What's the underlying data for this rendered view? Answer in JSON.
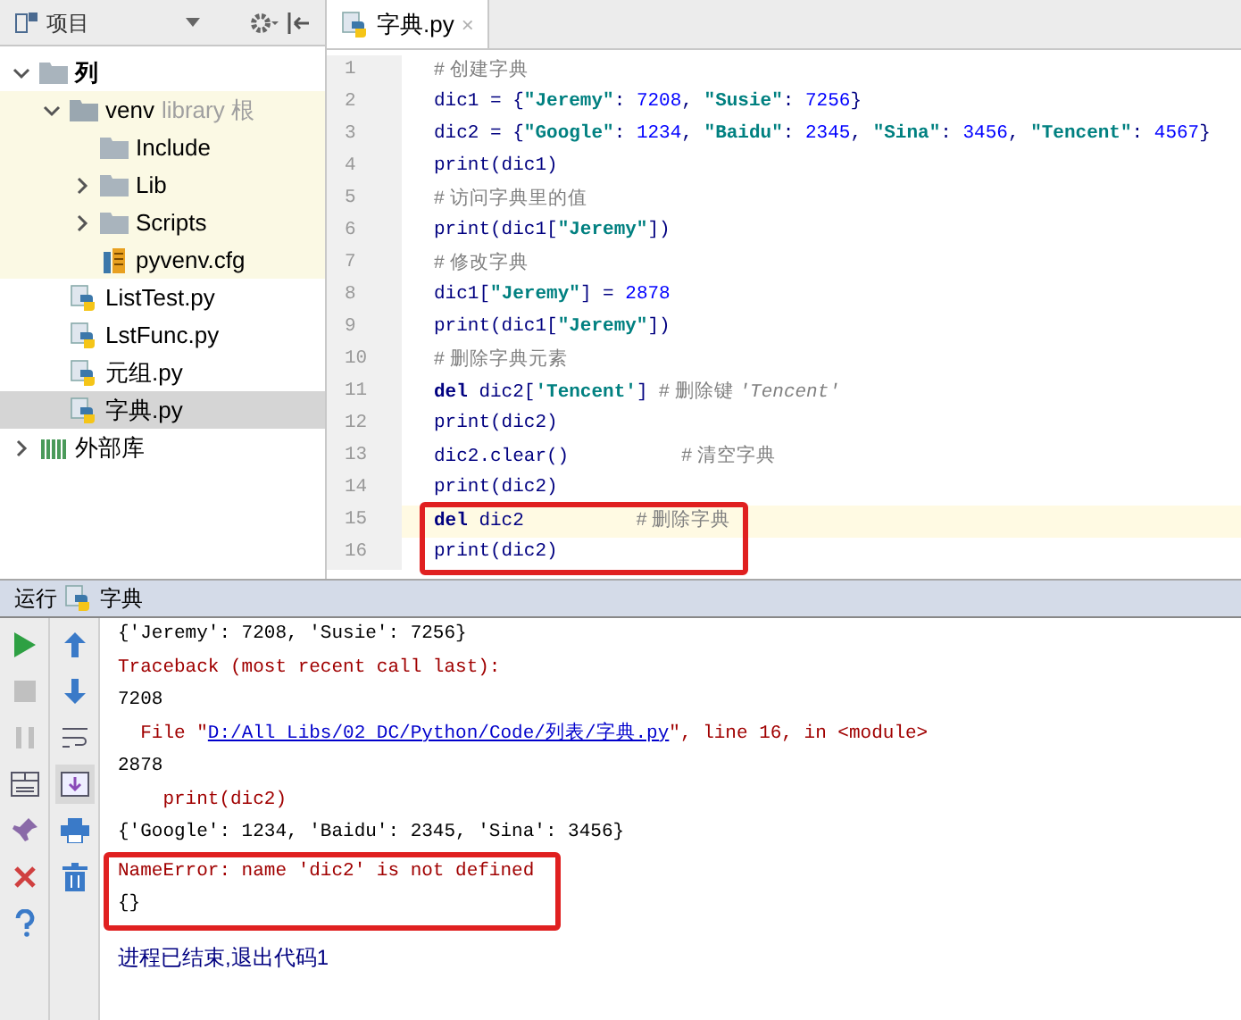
{
  "project_panel": {
    "title": "项目",
    "tree": [
      {
        "label": "列",
        "kind": "folder",
        "bold": true,
        "expanded": true,
        "selected": false,
        "children": [
          {
            "label": "venv",
            "suffix": "library 根",
            "kind": "folder",
            "library": true,
            "expanded": true,
            "selected": false,
            "children": [
              {
                "label": "Include",
                "kind": "folder",
                "selected": false
              },
              {
                "label": "Lib",
                "kind": "folder",
                "expanded": false,
                "selected": false
              },
              {
                "label": "Scripts",
                "kind": "folder",
                "expanded": false,
                "selected": false
              },
              {
                "label": "pyvenv.cfg",
                "kind": "cfg",
                "selected": false
              }
            ]
          },
          {
            "label": "ListTest.py",
            "kind": "py",
            "selected": false
          },
          {
            "label": "LstFunc.py",
            "kind": "py",
            "selected": false
          },
          {
            "label": "元组.py",
            "kind": "py",
            "selected": false
          },
          {
            "label": "字典.py",
            "kind": "py",
            "selected": true
          }
        ]
      },
      {
        "label": "外部库",
        "kind": "lib",
        "expanded": false,
        "selected": false
      }
    ]
  },
  "editor": {
    "tabs": [
      {
        "label": "字典.py",
        "close": "×",
        "selected": true
      }
    ],
    "lines": [
      {
        "number": "1",
        "segments": [
          {
            "kind": "comment",
            "text": "# 创建字典"
          }
        ]
      },
      {
        "number": "2",
        "segments": [
          {
            "kind": "plain",
            "text": "dic1 = {"
          },
          {
            "kind": "string",
            "text": "\"Jeremy\""
          },
          {
            "kind": "plain",
            "text": ": "
          },
          {
            "kind": "number",
            "text": "7208"
          },
          {
            "kind": "plain",
            "text": ", "
          },
          {
            "kind": "string",
            "text": "\"Susie\""
          },
          {
            "kind": "plain",
            "text": ": "
          },
          {
            "kind": "number",
            "text": "7256"
          },
          {
            "kind": "plain",
            "text": "}"
          }
        ]
      },
      {
        "number": "3",
        "segments": [
          {
            "kind": "plain",
            "text": "dic2 = {"
          },
          {
            "kind": "string",
            "text": "\"Google\""
          },
          {
            "kind": "plain",
            "text": ": "
          },
          {
            "kind": "number",
            "text": "1234"
          },
          {
            "kind": "plain",
            "text": ", "
          },
          {
            "kind": "string",
            "text": "\"Baidu\""
          },
          {
            "kind": "plain",
            "text": ": "
          },
          {
            "kind": "number",
            "text": "2345"
          },
          {
            "kind": "plain",
            "text": ", "
          },
          {
            "kind": "string",
            "text": "\"Sina\""
          },
          {
            "kind": "plain",
            "text": ": "
          },
          {
            "kind": "number",
            "text": "3456"
          },
          {
            "kind": "plain",
            "text": ", "
          },
          {
            "kind": "string",
            "text": "\"Tencent\""
          },
          {
            "kind": "plain",
            "text": ": "
          },
          {
            "kind": "number",
            "text": "4567"
          },
          {
            "kind": "plain",
            "text": "}"
          }
        ]
      },
      {
        "number": "4",
        "segments": [
          {
            "kind": "plain",
            "text": "print(dic1)"
          }
        ]
      },
      {
        "number": "5",
        "segments": [
          {
            "kind": "comment",
            "text": "# 访问字典里的值"
          }
        ]
      },
      {
        "number": "6",
        "segments": [
          {
            "kind": "plain",
            "text": "print(dic1["
          },
          {
            "kind": "string",
            "text": "\"Jeremy\""
          },
          {
            "kind": "plain",
            "text": "])"
          }
        ]
      },
      {
        "number": "7",
        "segments": [
          {
            "kind": "comment",
            "text": "# 修改字典"
          }
        ]
      },
      {
        "number": "8",
        "segments": [
          {
            "kind": "plain",
            "text": "dic1["
          },
          {
            "kind": "string",
            "text": "\"Jeremy\""
          },
          {
            "kind": "plain",
            "text": "] = "
          },
          {
            "kind": "number",
            "text": "2878"
          }
        ]
      },
      {
        "number": "9",
        "segments": [
          {
            "kind": "plain",
            "text": "print(dic1["
          },
          {
            "kind": "string",
            "text": "\"Jeremy\""
          },
          {
            "kind": "plain",
            "text": "])"
          }
        ]
      },
      {
        "number": "10",
        "segments": [
          {
            "kind": "comment",
            "text": "# 删除字典元素"
          }
        ]
      },
      {
        "number": "11",
        "segments": [
          {
            "kind": "keyword",
            "text": "del"
          },
          {
            "kind": "plain",
            "text": " dic2["
          },
          {
            "kind": "string",
            "text": "'Tencent'"
          },
          {
            "kind": "plain",
            "text": "] "
          },
          {
            "kind": "comment",
            "text": "# 删除键 "
          },
          {
            "kind": "docstring",
            "text": "'Tencent'"
          }
        ]
      },
      {
        "number": "12",
        "segments": [
          {
            "kind": "plain",
            "text": "print(dic2)"
          }
        ]
      },
      {
        "number": "13",
        "segments": [
          {
            "kind": "plain",
            "text": "dic2.clear()          "
          },
          {
            "kind": "comment",
            "text": "# 清空字典"
          }
        ]
      },
      {
        "number": "14",
        "segments": [
          {
            "kind": "plain",
            "text": "print(dic2)"
          }
        ]
      },
      {
        "number": "15",
        "current": true,
        "boxed": true,
        "segments": [
          {
            "kind": "keyword",
            "text": "del"
          },
          {
            "kind": "plain",
            "text": " dic2          "
          },
          {
            "kind": "comment",
            "text": "# 删除字典"
          }
        ]
      },
      {
        "number": "16",
        "current": false,
        "boxed": true,
        "segments": [
          {
            "kind": "plain",
            "text": "print(dic2)"
          }
        ]
      }
    ]
  },
  "run_panel": {
    "title": "运行",
    "config": "字典",
    "lines": [
      {
        "kind": "normal",
        "segments": [
          {
            "kind": "plain",
            "text": "{'Jeremy': 7208, 'Susie': 7256}"
          }
        ]
      },
      {
        "kind": "error",
        "segments": [
          {
            "kind": "plain",
            "text": "Traceback (most recent call last):"
          }
        ]
      },
      {
        "kind": "normal",
        "segments": [
          {
            "kind": "plain",
            "text": "7208"
          }
        ]
      },
      {
        "kind": "error",
        "segments": [
          {
            "kind": "plain",
            "text": "  File \""
          },
          {
            "kind": "link",
            "text": "D:/All Libs/02 DC/Python/Code/列表/字典.py"
          },
          {
            "kind": "plain",
            "text": "\", line 16, in <module>"
          }
        ]
      },
      {
        "kind": "normal",
        "segments": [
          {
            "kind": "plain",
            "text": "2878"
          }
        ]
      },
      {
        "kind": "error",
        "segments": [
          {
            "kind": "plain",
            "text": "    print(dic2)"
          }
        ]
      },
      {
        "kind": "normal",
        "segments": [
          {
            "kind": "plain",
            "text": "{'Google': 1234, 'Baidu': 2345, 'Sina': 3456}"
          }
        ]
      },
      {
        "kind": "error",
        "boxed": true,
        "segments": [
          {
            "kind": "plain",
            "text": "NameError: name 'dic2' is not defined"
          }
        ]
      },
      {
        "kind": "normal",
        "boxed": true,
        "segments": [
          {
            "kind": "plain",
            "text": "{}"
          }
        ]
      },
      {
        "kind": "exit",
        "segments": [
          {
            "kind": "plain",
            "text": "进程已结束,退出代码1"
          }
        ]
      }
    ]
  }
}
